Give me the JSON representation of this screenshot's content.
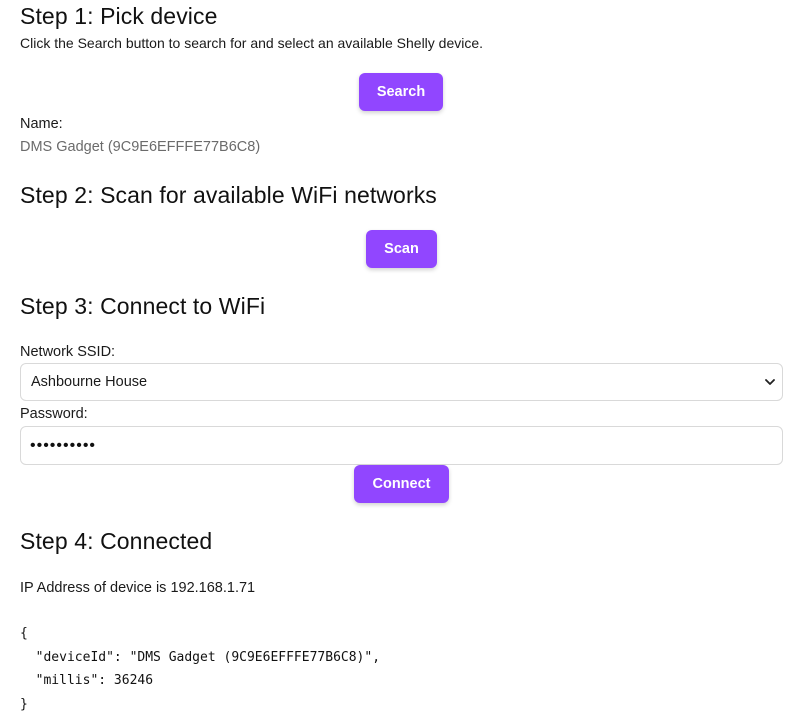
{
  "step1": {
    "title": "Step 1: Pick device",
    "description": "Click the Search button to search for and select an available Shelly device.",
    "search_label": "Search",
    "name_label": "Name:",
    "name_value": "DMS Gadget (9C9E6EFFFE77B6C8)"
  },
  "step2": {
    "title": "Step 2: Scan for available WiFi networks",
    "scan_label": "Scan"
  },
  "step3": {
    "title": "Step 3: Connect to WiFi",
    "ssid_label": "Network SSID:",
    "ssid_value": "Ashbourne House",
    "password_label": "Password:",
    "password_value": "••••••••••",
    "connect_label": "Connect"
  },
  "step4": {
    "title": "Step 4: Connected",
    "ip_prefix": "IP Address of device is ",
    "ip_value": "192.168.1.71",
    "json_lines": [
      "{",
      "  \"deviceId\": \"DMS Gadget (9C9E6EFFFE77B6C8)\",",
      "  \"millis\": 36246",
      "}"
    ]
  },
  "icons": {
    "select_arrow": "chevron-down-icon"
  },
  "colors": {
    "accent": "#9146ff",
    "muted_text": "#6b6b6b",
    "border": "#d9d9d9"
  }
}
